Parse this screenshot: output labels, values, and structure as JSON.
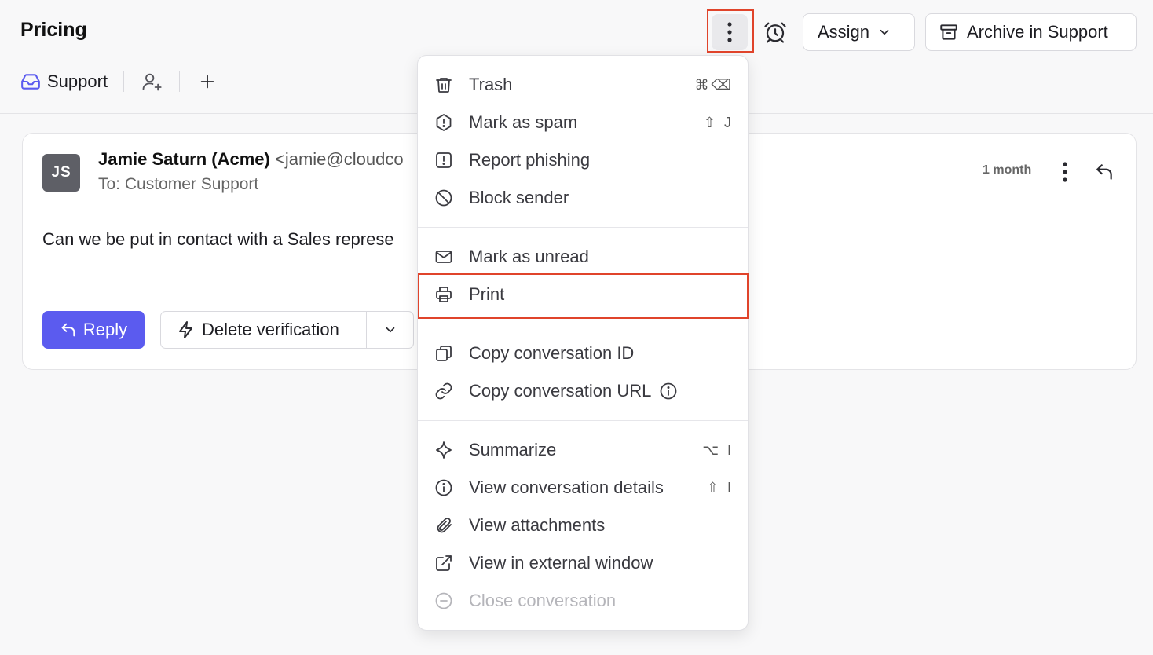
{
  "header": {
    "title": "Pricing",
    "assign_label": "Assign",
    "archive_label": "Archive in Support"
  },
  "tabs": {
    "inbox_label": "Support"
  },
  "message": {
    "avatar_initials": "JS",
    "sender_name": "Jamie Saturn (Acme)",
    "sender_email": "<jamie@cloudco",
    "to_line": "To: Customer Support",
    "time": "1 month",
    "body": "Can we be put in contact with a Sales represe",
    "reply_label": "Reply",
    "macro_label": "Delete verification"
  },
  "menu": {
    "items": [
      {
        "label": "Trash",
        "shortcut": "⌘⌫",
        "icon": "trash-icon"
      },
      {
        "label": "Mark as spam",
        "shortcut": "⇧ J",
        "icon": "spam-icon"
      },
      {
        "label": "Report phishing",
        "shortcut": "",
        "icon": "report-icon"
      },
      {
        "label": "Block sender",
        "shortcut": "",
        "icon": "block-icon"
      },
      {
        "label": "Mark as unread",
        "shortcut": "",
        "icon": "envelope-icon"
      },
      {
        "label": "Print",
        "shortcut": "",
        "icon": "printer-icon"
      },
      {
        "label": "Copy conversation ID",
        "shortcut": "",
        "icon": "copy-icon"
      },
      {
        "label": "Copy conversation URL",
        "shortcut": "",
        "icon": "link-icon"
      },
      {
        "label": "Summarize",
        "shortcut": "⌥ I",
        "icon": "sparkle-icon"
      },
      {
        "label": "View conversation details",
        "shortcut": "⇧ I",
        "icon": "info-icon"
      },
      {
        "label": "View attachments",
        "shortcut": "",
        "icon": "paperclip-icon"
      },
      {
        "label": "View in external window",
        "shortcut": "",
        "icon": "external-link-icon"
      },
      {
        "label": "Close conversation",
        "shortcut": "",
        "icon": "minus-circle-icon"
      }
    ]
  },
  "colors": {
    "accent": "#5b5bef",
    "highlight": "#e0442b",
    "support_icon": "#5b5bef"
  }
}
